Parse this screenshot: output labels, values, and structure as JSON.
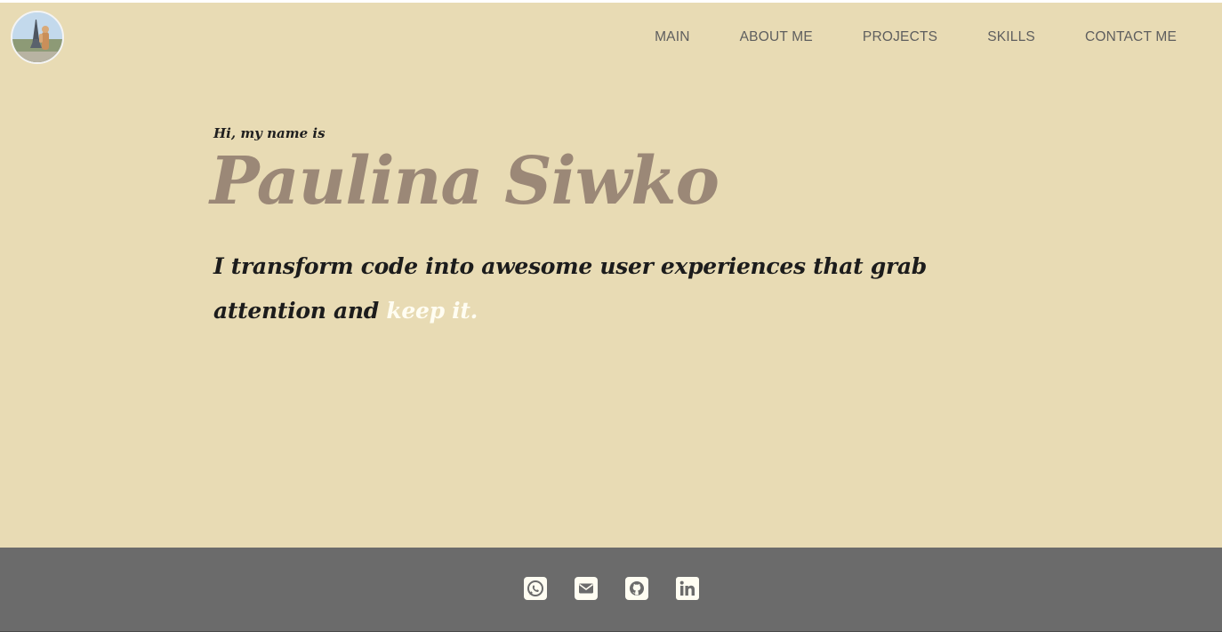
{
  "header": {
    "avatar_alt": "Profile photo",
    "nav": [
      {
        "label": "MAIN"
      },
      {
        "label": "ABOUT ME"
      },
      {
        "label": "PROJECTS"
      },
      {
        "label": "SKILLS"
      },
      {
        "label": "CONTACT ME"
      }
    ]
  },
  "hero": {
    "greeting": "Hi, my name is",
    "name": "Paulina Siwko",
    "tagline_main": "I transform code into awesome user experiences that grab attention and ",
    "tagline_highlight": "keep it."
  },
  "footer": {
    "social": [
      {
        "icon": "whatsapp-icon"
      },
      {
        "icon": "email-icon"
      },
      {
        "icon": "github-icon"
      },
      {
        "icon": "linkedin-icon"
      }
    ]
  },
  "colors": {
    "background": "#e8dbb4",
    "name": "#9b8877",
    "text": "#1c1c1c",
    "highlight": "#fffdf2",
    "footer": "#6b6b6b",
    "nav": "#5e5e5e"
  }
}
